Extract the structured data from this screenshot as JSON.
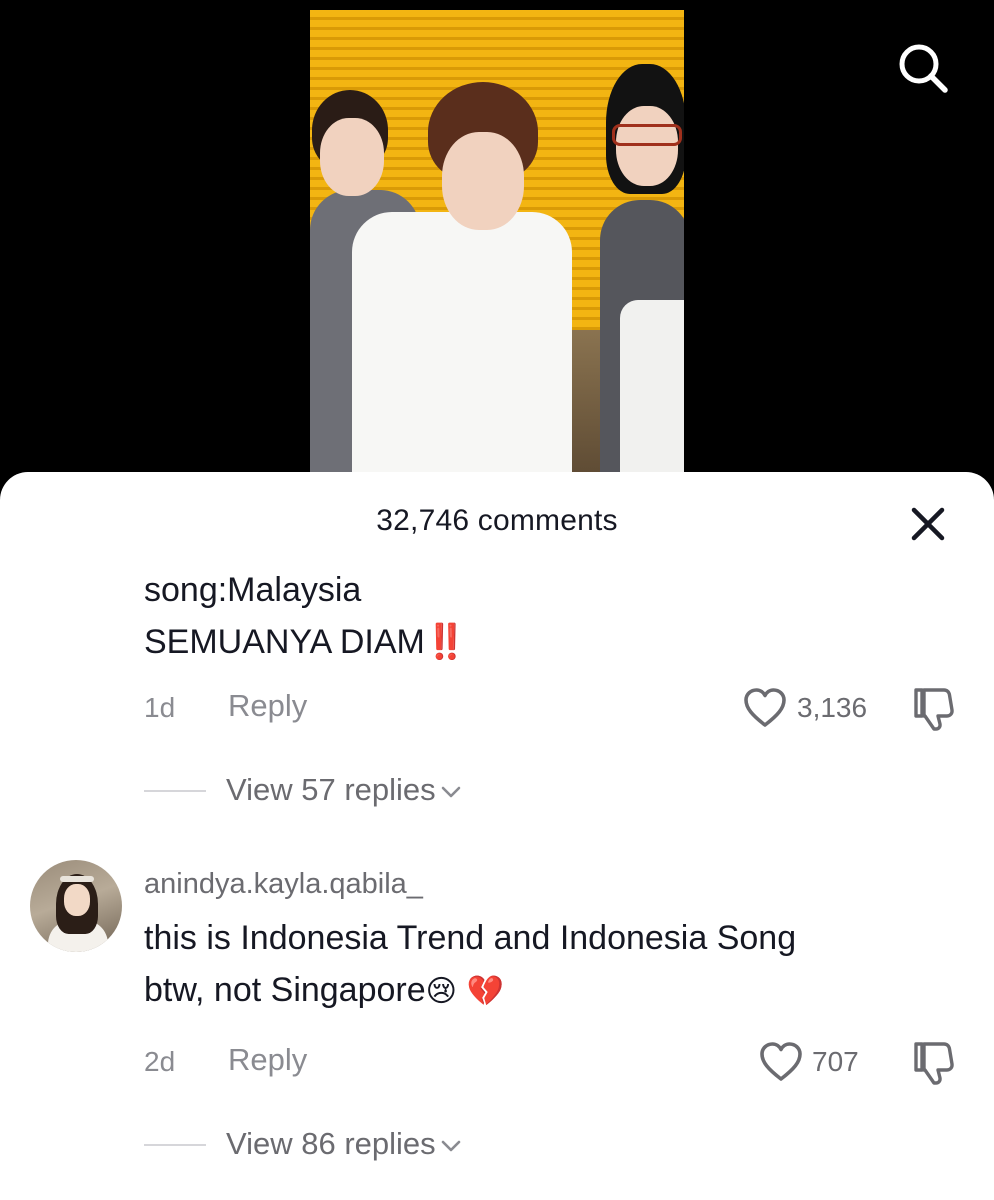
{
  "video": {
    "search_icon": "search-icon"
  },
  "comments_sheet": {
    "title": "32,746 comments",
    "close_icon": "close-icon",
    "comments": [
      {
        "lines": [
          "song:Malaysia",
          "SEMUANYA DIAM"
        ],
        "emoji": "‼️",
        "time": "1d",
        "reply_label": "Reply",
        "likes": "3,136",
        "view_replies": "View 57 replies"
      },
      {
        "username": "anindya.kayla.qabila_",
        "lines": [
          "this is Indonesia Trend and Indonesia Song",
          "btw, not Singapore"
        ],
        "emoji": "😢 💔",
        "time": "2d",
        "reply_label": "Reply",
        "likes": "707",
        "view_replies": "View 86 replies"
      }
    ]
  },
  "colors": {
    "video_bg": "#000000",
    "sheet_bg": "#ffffff",
    "text_primary": "#161823",
    "text_secondary": "#8a8b91",
    "emoji_red": "#e0221c"
  }
}
